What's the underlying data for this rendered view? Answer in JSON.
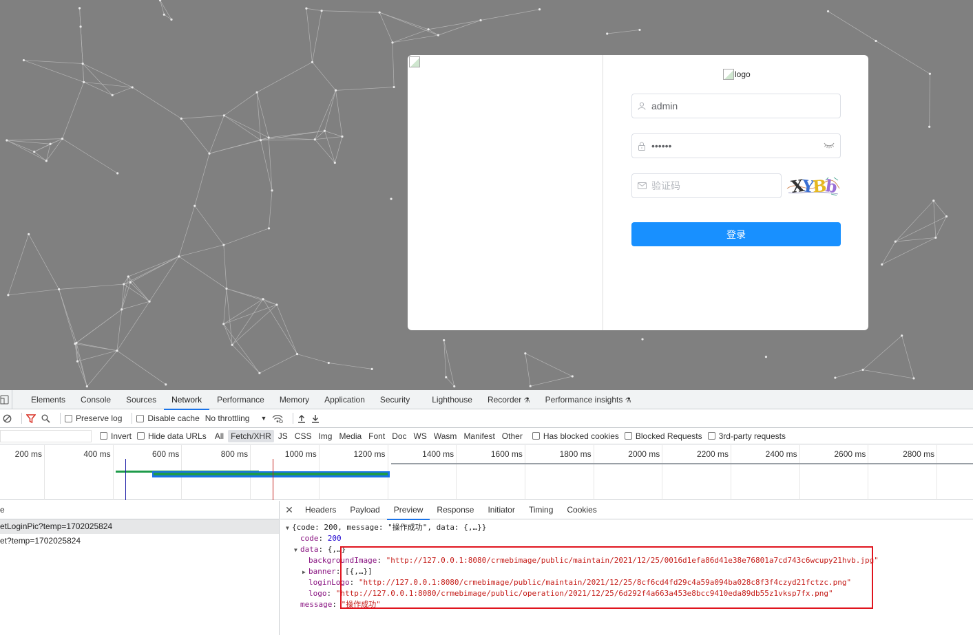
{
  "login": {
    "logo_alt": "logo",
    "username_value": "admin",
    "password_value": "••••••",
    "captcha_placeholder": "验证码",
    "captcha_text": [
      "X",
      "Y",
      "B",
      "b"
    ],
    "login_button": "登录",
    "colors": {
      "primary": "#1890ff",
      "background": "#808080"
    }
  },
  "devtools": {
    "tabs": [
      "Elements",
      "Console",
      "Sources",
      "Network",
      "Performance",
      "Memory",
      "Application",
      "Security",
      "Lighthouse",
      "Recorder",
      "Performance insights"
    ],
    "active_tab": "Network",
    "toolbar": {
      "preserve_log": "Preserve log",
      "disable_cache": "Disable cache",
      "throttling": "No throttling"
    },
    "filters": {
      "invert": "Invert",
      "hide_data_urls": "Hide data URLs",
      "types": [
        "All",
        "Fetch/XHR",
        "JS",
        "CSS",
        "Img",
        "Media",
        "Font",
        "Doc",
        "WS",
        "Wasm",
        "Manifest",
        "Other"
      ],
      "active_type": "Fetch/XHR",
      "has_blocked_cookies": "Has blocked cookies",
      "blocked_requests": "Blocked Requests",
      "third_party": "3rd-party requests"
    },
    "timeline_ticks": [
      "200 ms",
      "400 ms",
      "600 ms",
      "800 ms",
      "1000 ms",
      "1200 ms",
      "1400 ms",
      "1600 ms",
      "1800 ms",
      "2000 ms",
      "2200 ms",
      "2400 ms",
      "2600 ms",
      "2800 ms"
    ],
    "request_list": {
      "header": "e",
      "rows": [
        "etLoginPic?temp=1702025824",
        "et?temp=1702025824"
      ]
    },
    "detail_tabs": [
      "Headers",
      "Payload",
      "Preview",
      "Response",
      "Initiator",
      "Timing",
      "Cookies"
    ],
    "active_detail_tab": "Preview",
    "preview": {
      "root": "{code: 200, message: \"操作成功\", data: {,…}}",
      "code_key": "code",
      "code_val": "200",
      "data_key": "data",
      "data_summary": "{,…}",
      "bg_key": "backgroundImage",
      "bg_val": "\"http://127.0.0.1:8080/crmebimage/public/maintain/2021/12/25/0016d1efa86d41e38e76801a7cd743c6wcupy21hvb.jpg\"",
      "banner_key": "banner",
      "banner_val": "[{,…}]",
      "loginlogo_key": "loginLogo",
      "loginlogo_val": "\"http://127.0.0.1:8080/crmebimage/public/maintain/2021/12/25/8cf6cd4fd29c4a59a094ba028c8f3f4czyd21fctzc.png\"",
      "logo_key": "logo",
      "logo_val": "\"http://127.0.0.1:8080/crmebimage/public/operation/2021/12/25/6d292f4a663a453e8bcc9410eda89db55z1vksp7fx.png\"",
      "message_key": "message",
      "message_val": "\"操作成功\""
    }
  }
}
